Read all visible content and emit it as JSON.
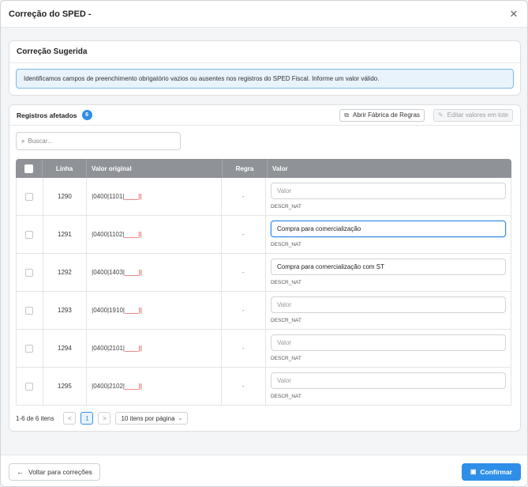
{
  "modal": {
    "title": "Correção do SPED -"
  },
  "suggestion": {
    "title": "Correção Sugerida",
    "message": "Identificamos campos de preenchimento obrigatório vazios ou ausentes nos registros do SPED Fiscal. Informe um valor válido."
  },
  "registers": {
    "title": "Registros afetados",
    "count": "6",
    "open_rules_label": "Abrir Fábrica de Regras",
    "edit_batch_label": "Editar valores em lote",
    "search_placeholder": "Buscar..."
  },
  "table": {
    "headers": {
      "linha": "Linha",
      "valor": "Valor original",
      "regra": "Regra",
      "input": "Valor"
    },
    "rows": [
      {
        "linha": "1290",
        "orig": "|0400|1101|",
        "blank": "____",
        "end": "||",
        "regra": "-",
        "value": "",
        "placeholder": "Valor",
        "field": "DESCR_NAT"
      },
      {
        "linha": "1291",
        "orig": "|0400|1102|",
        "blank": "____",
        "end": "||",
        "regra": "-",
        "value": "Compra para comercialização",
        "placeholder": "Valor",
        "field": "DESCR_NAT"
      },
      {
        "linha": "1292",
        "orig": "|0400|1403|",
        "blank": "____",
        "end": "||",
        "regra": "-",
        "value": "Compra para comercialização com ST",
        "placeholder": "Valor",
        "field": "DESCR_NAT"
      },
      {
        "linha": "1293",
        "orig": "|0400|1910|",
        "blank": "____",
        "end": "||",
        "regra": "-",
        "value": "",
        "placeholder": "Valor",
        "field": "DESCR_NAT"
      },
      {
        "linha": "1294",
        "orig": "|0400|2101|",
        "blank": "____",
        "end": "||",
        "regra": "-",
        "value": "",
        "placeholder": "Valor",
        "field": "DESCR_NAT"
      },
      {
        "linha": "1295",
        "orig": "|0400|2102|",
        "blank": "____",
        "end": "||",
        "regra": "-",
        "value": "",
        "placeholder": "Valor",
        "field": "DESCR_NAT"
      }
    ]
  },
  "pagination": {
    "info": "1-6 de 6 itens",
    "prev": "<",
    "page": "1",
    "next": ">",
    "per_page": "10 itens por página"
  },
  "footer": {
    "back_label": "Voltar para correções",
    "confirm_label": "Confirmar"
  },
  "colors": {
    "accent": "#2f8ee8",
    "alert_bg": "#e8f3fc",
    "header_gray": "#8f9297",
    "blank_red": "#dd2222"
  },
  "icons": {
    "close": "close-icon",
    "open_rules": "external-link-icon",
    "edit": "pencil-icon",
    "search": "search-icon",
    "back": "arrow-left-icon",
    "confirm": "save-icon"
  }
}
